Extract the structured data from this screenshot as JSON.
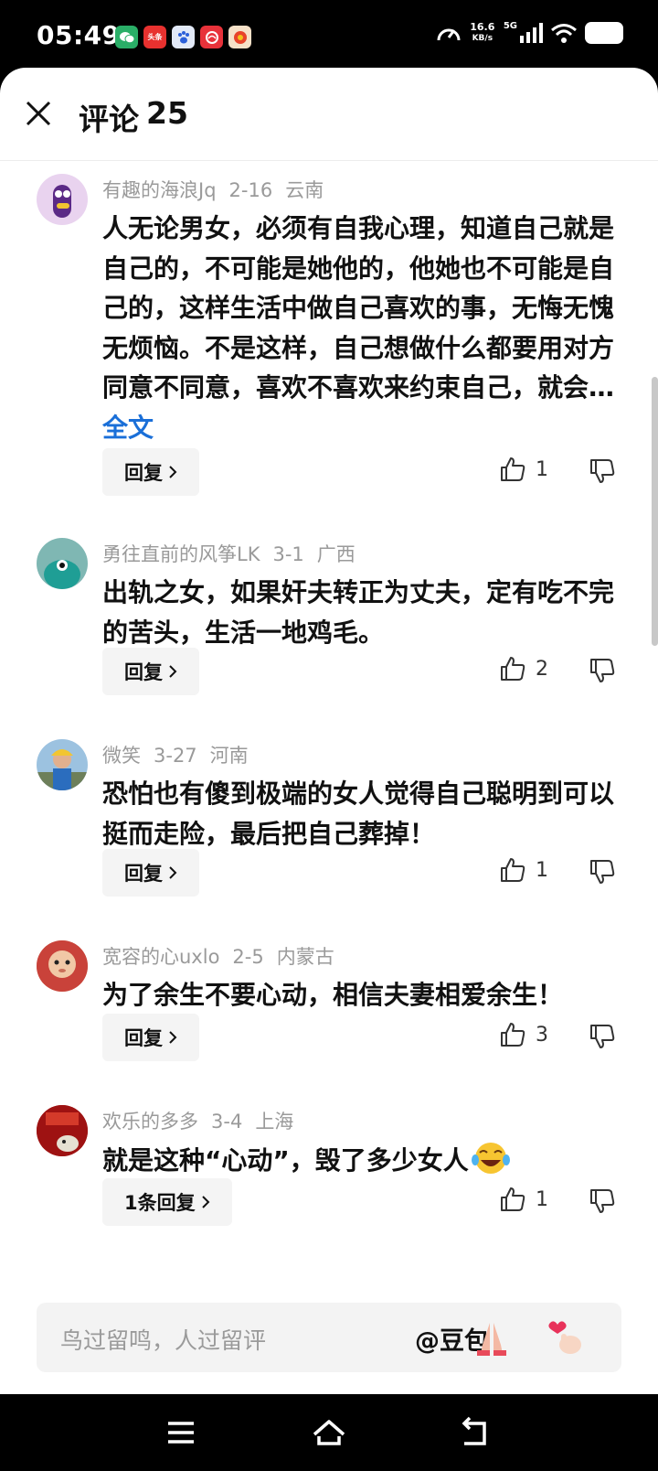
{
  "status_bar": {
    "time": "05:49",
    "net_speed_value": "16.6",
    "net_speed_unit": "KB/s",
    "signal_label": "5G",
    "apps": [
      {
        "icon": "wechat-icon",
        "color": "#2aae67",
        "label": ""
      },
      {
        "icon": "toutiao-icon",
        "color": "#e8312f",
        "label": "头条"
      },
      {
        "icon": "baidu-icon",
        "color": "#e2e9f7",
        "label": ""
      },
      {
        "icon": "app-red-icon",
        "color": "#e8323a",
        "label": ""
      },
      {
        "icon": "app-orange-icon",
        "color": "#f39a1c",
        "label": ""
      }
    ]
  },
  "header": {
    "title": "评论",
    "count": "25"
  },
  "comments": [
    {
      "user": "有趣的海浪Jq",
      "date": "2-16",
      "location": "云南",
      "text": "人无论男女，必须有自我心理，知道自己就是自己的，不可能是她他的，他她也不可能是自己的，这样生活中做自己喜欢的事，无悔无愧无烦恼。不是这样，自己想做什么都要用对方同意不同意，喜欢不喜欢来约束自己，就会…",
      "more_label": "全文",
      "reply_label": "回复",
      "likes": "1"
    },
    {
      "user": "勇往直前的风筝LK",
      "date": "3-1",
      "location": "广西",
      "text": "出轨之女，如果奸夫转正为丈夫，定有吃不完的苦头，生活一地鸡毛。",
      "reply_label": "回复",
      "likes": "2"
    },
    {
      "user": "微笑",
      "date": "3-27",
      "location": "河南",
      "text": "恐怕也有傻到极端的女人觉得自己聪明到可以挺而走险，最后把自己葬掉！",
      "reply_label": "回复",
      "likes": "1"
    },
    {
      "user": "宽容的心uxlo",
      "date": "2-5",
      "location": "内蒙古",
      "text": "为了余生不要心动，相信夫妻相爱余生！",
      "reply_label": "回复",
      "likes": "3"
    },
    {
      "user": "欢乐的多多",
      "date": "3-4",
      "location": "上海",
      "text": "就是这种“心动”，毁了多少女人",
      "emoji": "laughing-crying-emoji",
      "reply_label": "1条回复",
      "likes": "1"
    }
  ],
  "input_bar": {
    "placeholder": "鸟过留鸣，人过留评",
    "mention_label": "@豆包",
    "emojis": [
      "praying-hands-icon",
      "finger-heart-icon"
    ]
  },
  "nav_bar": {
    "items": [
      "menu-icon",
      "home-icon",
      "back-icon"
    ]
  },
  "colors": {
    "link": "#1a6fd8",
    "meta": "#9a9a9a",
    "text": "#111111",
    "reply_bg": "#f4f4f4"
  }
}
